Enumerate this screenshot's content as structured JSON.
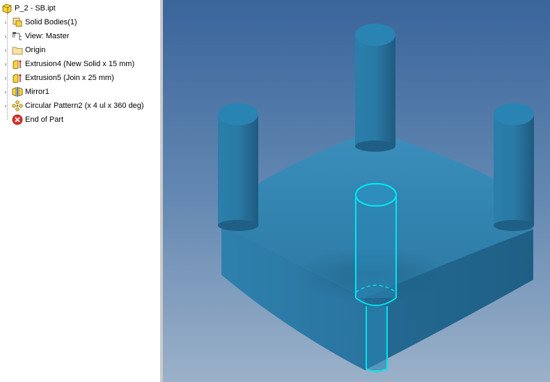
{
  "browser": {
    "root": {
      "label": "P_2 - SB.ipt",
      "icon": "part-cube-icon"
    },
    "items": [
      {
        "label": "Solid Bodies(1)",
        "icon": "solid-bodies-icon"
      },
      {
        "label": "View: Master",
        "icon": "view-rep-icon"
      },
      {
        "label": "Origin",
        "icon": "folder-icon"
      },
      {
        "label": "Extrusion4 (New Solid x 15 mm)",
        "icon": "extrusion-icon"
      },
      {
        "label": "Extrusion5 (Join x 25 mm)",
        "icon": "extrusion-icon"
      },
      {
        "label": "Mirror1",
        "icon": "mirror-icon"
      },
      {
        "label": "Circular Pattern2 (x 4 ul x 360 deg)",
        "icon": "circular-pattern-icon"
      },
      {
        "label": "End of Part",
        "icon": "end-of-part-icon"
      }
    ]
  },
  "colors": {
    "model": "#2a7ca4",
    "highlight": "#00e6f0",
    "viewport_top": "#3a659b",
    "viewport_bottom": "#9bb1c9"
  }
}
